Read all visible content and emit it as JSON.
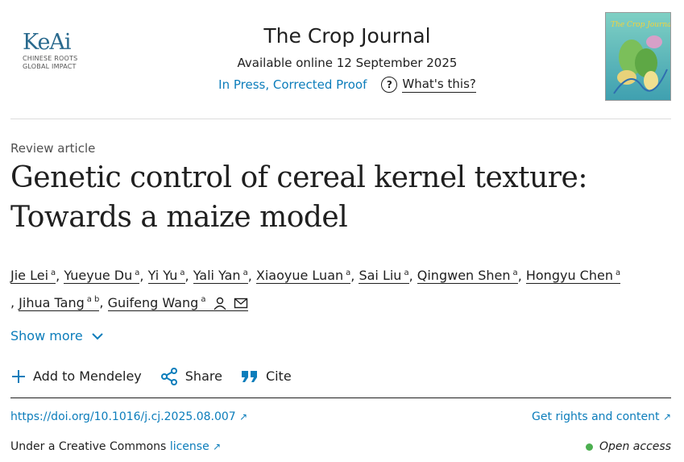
{
  "publisher_logo": {
    "name": "KeAi",
    "tagline_line1": "CHINESE ROOTS",
    "tagline_line2": "GLOBAL IMPACT"
  },
  "journal": {
    "title": "The Crop Journal",
    "available": "Available online 12 September 2025",
    "status": "In Press, Corrected Proof",
    "whats_this": "What's this?",
    "cover_text": "The Crop Journal"
  },
  "article": {
    "type": "Review article",
    "title_line1": "Genetic control of cereal kernel texture:",
    "title_line2": "Towards a maize model"
  },
  "authors": [
    {
      "name": "Jie Lei",
      "aff": "a"
    },
    {
      "name": "Yueyue Du",
      "aff": "a"
    },
    {
      "name": "Yi Yu",
      "aff": "a"
    },
    {
      "name": "Yali Yan",
      "aff": "a"
    },
    {
      "name": "Xiaoyue Luan",
      "aff": "a"
    },
    {
      "name": "Sai Liu",
      "aff": "a"
    },
    {
      "name": "Qingwen Shen",
      "aff": "a"
    },
    {
      "name": "Hongyu Chen",
      "aff": "a"
    },
    {
      "name": "Jihua Tang",
      "aff": "a b"
    },
    {
      "name": "Guifeng Wang",
      "aff": "a"
    }
  ],
  "show_more": "Show more",
  "actions": {
    "mendeley": "Add to Mendeley",
    "share": "Share",
    "cite": "Cite"
  },
  "doi": "https://doi.org/10.1016/j.cj.2025.08.007",
  "rights": "Get rights and content",
  "license": {
    "prefix": "Under a Creative Commons",
    "link": "license"
  },
  "open_access": "Open access",
  "colors": {
    "link": "#0c7dbb",
    "text": "#1f1f1f",
    "open_access_dot": "#4caf50",
    "logo": "#2a6a8e"
  }
}
